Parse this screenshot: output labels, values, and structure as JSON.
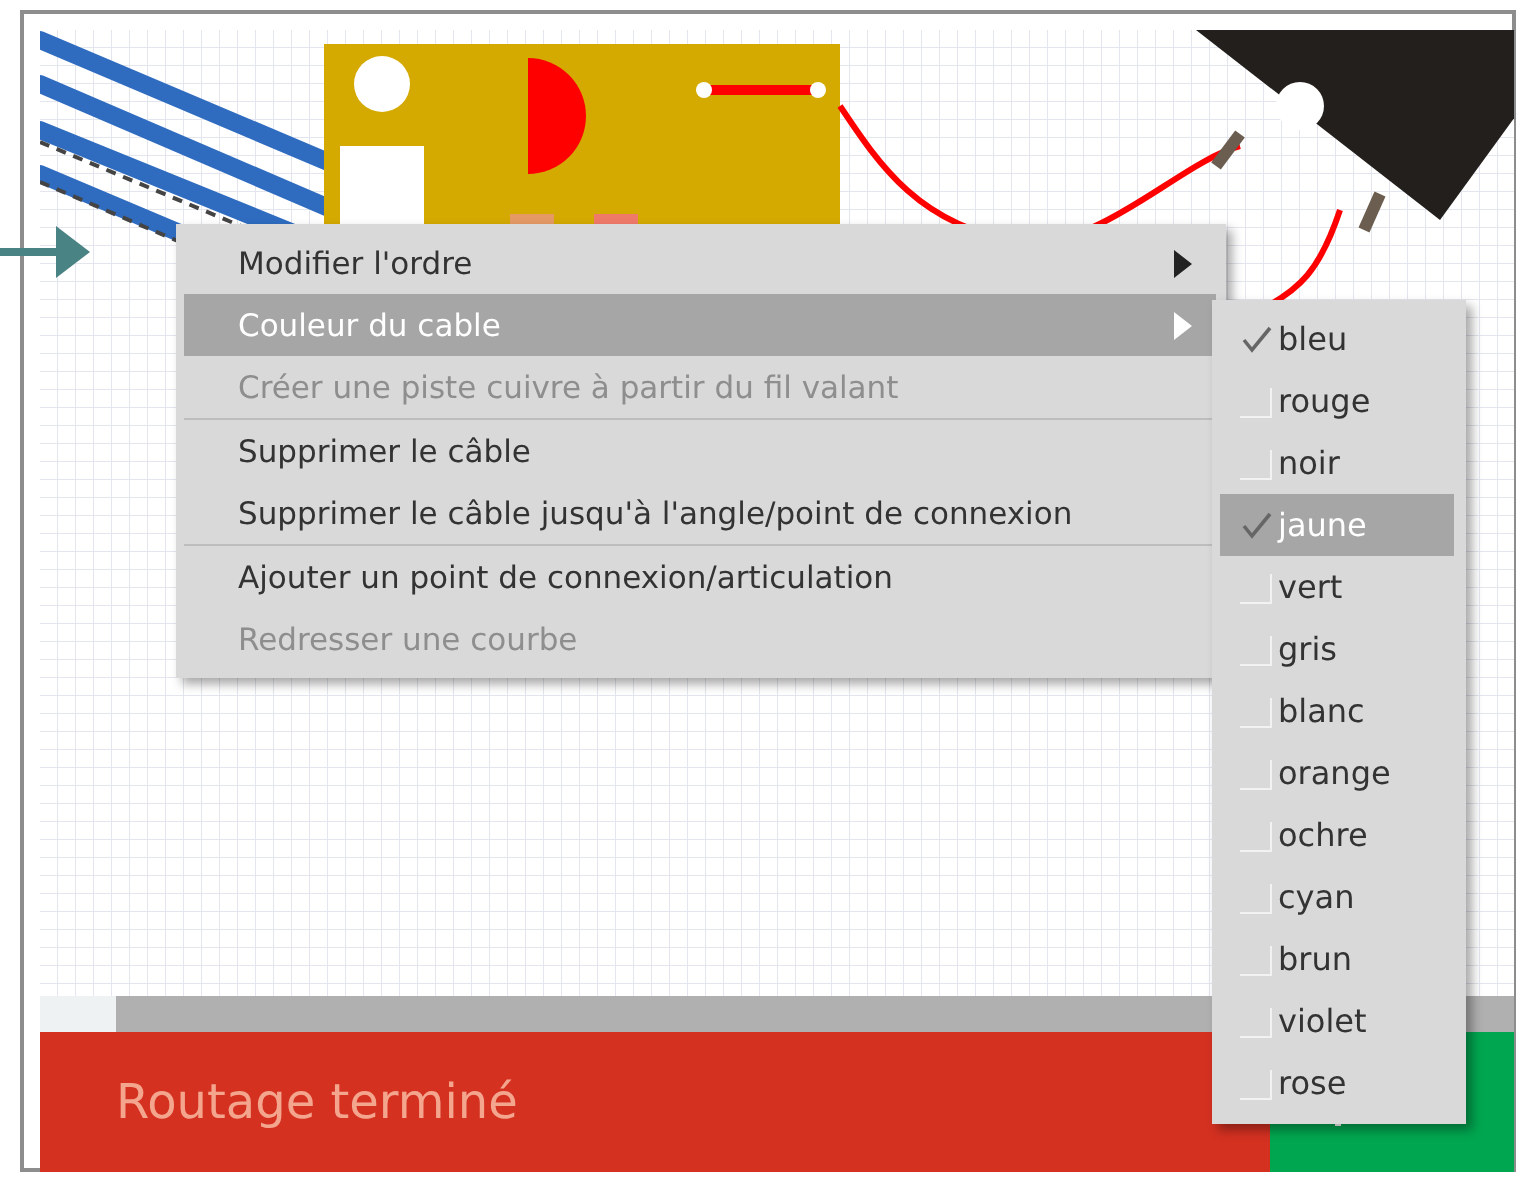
{
  "context_menu": {
    "items": [
      {
        "kind": "item",
        "label": "Modifier l'ordre",
        "disabled": false,
        "selected": false,
        "submenu": true
      },
      {
        "kind": "item",
        "label": "Couleur du cable",
        "disabled": false,
        "selected": true,
        "submenu": true
      },
      {
        "kind": "item",
        "label": "Créer une piste cuivre à partir du fil valant",
        "disabled": true,
        "selected": false,
        "submenu": false
      },
      {
        "kind": "separator"
      },
      {
        "kind": "item",
        "label": "Supprimer le câble",
        "disabled": false,
        "selected": false,
        "submenu": false
      },
      {
        "kind": "item",
        "label": "Supprimer le câble jusqu'à l'angle/point de connexion",
        "disabled": false,
        "selected": false,
        "submenu": false
      },
      {
        "kind": "separator"
      },
      {
        "kind": "item",
        "label": "Ajouter un point de connexion/articulation",
        "disabled": false,
        "selected": false,
        "submenu": false
      },
      {
        "kind": "item",
        "label": "Redresser une courbe",
        "disabled": true,
        "selected": false,
        "submenu": false
      }
    ]
  },
  "color_submenu": {
    "items": [
      {
        "label": "bleu",
        "checked": true,
        "selected": false
      },
      {
        "label": "rouge",
        "checked": false,
        "selected": false
      },
      {
        "label": "noir",
        "checked": false,
        "selected": false
      },
      {
        "label": "jaune",
        "checked": true,
        "selected": true
      },
      {
        "label": "vert",
        "checked": false,
        "selected": false
      },
      {
        "label": "gris",
        "checked": false,
        "selected": false
      },
      {
        "label": "blanc",
        "checked": false,
        "selected": false
      },
      {
        "label": "orange",
        "checked": false,
        "selected": false
      },
      {
        "label": "ochre",
        "checked": false,
        "selected": false
      },
      {
        "label": "cyan",
        "checked": false,
        "selected": false
      },
      {
        "label": "brun",
        "checked": false,
        "selected": false
      },
      {
        "label": "violet",
        "checked": false,
        "selected": false
      },
      {
        "label": "rose",
        "checked": false,
        "selected": false
      }
    ]
  },
  "status_bar": {
    "message": "Routage terminé"
  }
}
